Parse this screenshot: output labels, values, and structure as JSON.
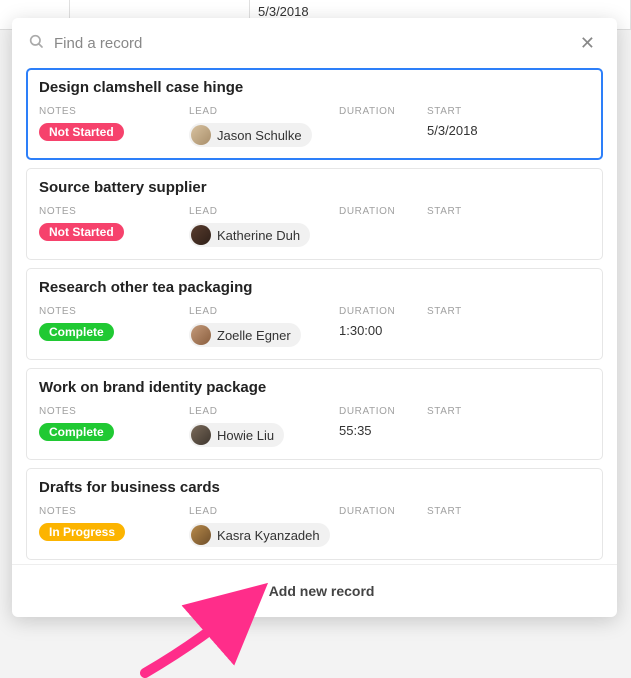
{
  "bg": {
    "date_cell": "5/3/2018"
  },
  "search": {
    "placeholder": "Find a record"
  },
  "labels": {
    "notes": "NOTES",
    "lead": "LEAD",
    "duration": "DURATION",
    "start": "START"
  },
  "records": [
    {
      "title": "Design clamshell case hinge",
      "status_text": "Not Started",
      "status_class": "status-not-started",
      "lead": "Jason Schulke",
      "avatar_bg": "linear-gradient(135deg,#d8c2a0,#a88e6a)",
      "duration": "",
      "start": "5/3/2018",
      "selected": true
    },
    {
      "title": "Source battery supplier",
      "status_text": "Not Started",
      "status_class": "status-not-started",
      "lead": "Katherine Duh",
      "avatar_bg": "linear-gradient(135deg,#5a3d2e,#2e1f18)",
      "duration": "",
      "start": "",
      "selected": false
    },
    {
      "title": "Research other tea packaging",
      "status_text": "Complete",
      "status_class": "status-complete",
      "lead": "Zoelle Egner",
      "avatar_bg": "linear-gradient(135deg,#c49a7a,#8a5e3e)",
      "duration": "1:30:00",
      "start": "",
      "selected": false
    },
    {
      "title": "Work on brand identity package",
      "status_text": "Complete",
      "status_class": "status-complete",
      "lead": "Howie Liu",
      "avatar_bg": "linear-gradient(135deg,#7a6a5a,#3e362e)",
      "duration": "55:35",
      "start": "",
      "selected": false
    },
    {
      "title": "Drafts for business cards",
      "status_text": "In Progress",
      "status_class": "status-in-progress",
      "lead": "Kasra Kyanzadeh",
      "avatar_bg": "linear-gradient(135deg,#b88a4a,#6e4e2a)",
      "duration": "",
      "start": "",
      "selected": false
    }
  ],
  "footer": {
    "add_label": "Add new record"
  }
}
